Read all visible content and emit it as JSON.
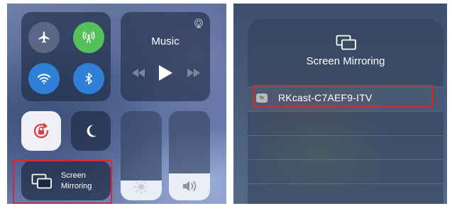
{
  "control_center": {
    "connectivity": {
      "airplane_icon": "airplane-icon",
      "cellular_icon": "cellular-data-icon",
      "wifi_icon": "wifi-icon",
      "bluetooth_icon": "bluetooth-icon"
    },
    "music": {
      "title": "Music"
    },
    "screen_mirroring": {
      "label_line1": "Screen",
      "label_line2": "Mirroring"
    },
    "brightness_level": 0.22,
    "volume_level": 0.3
  },
  "mirroring_sheet": {
    "title": "Screen Mirroring",
    "device_badge": "tv",
    "devices": [
      {
        "name": "RKcast-C7AEF9-ITV"
      }
    ]
  },
  "colors": {
    "highlight": "#d62a2a",
    "cellular_active": "#55c15b",
    "wifi_bluetooth_active": "#2f80d6"
  }
}
